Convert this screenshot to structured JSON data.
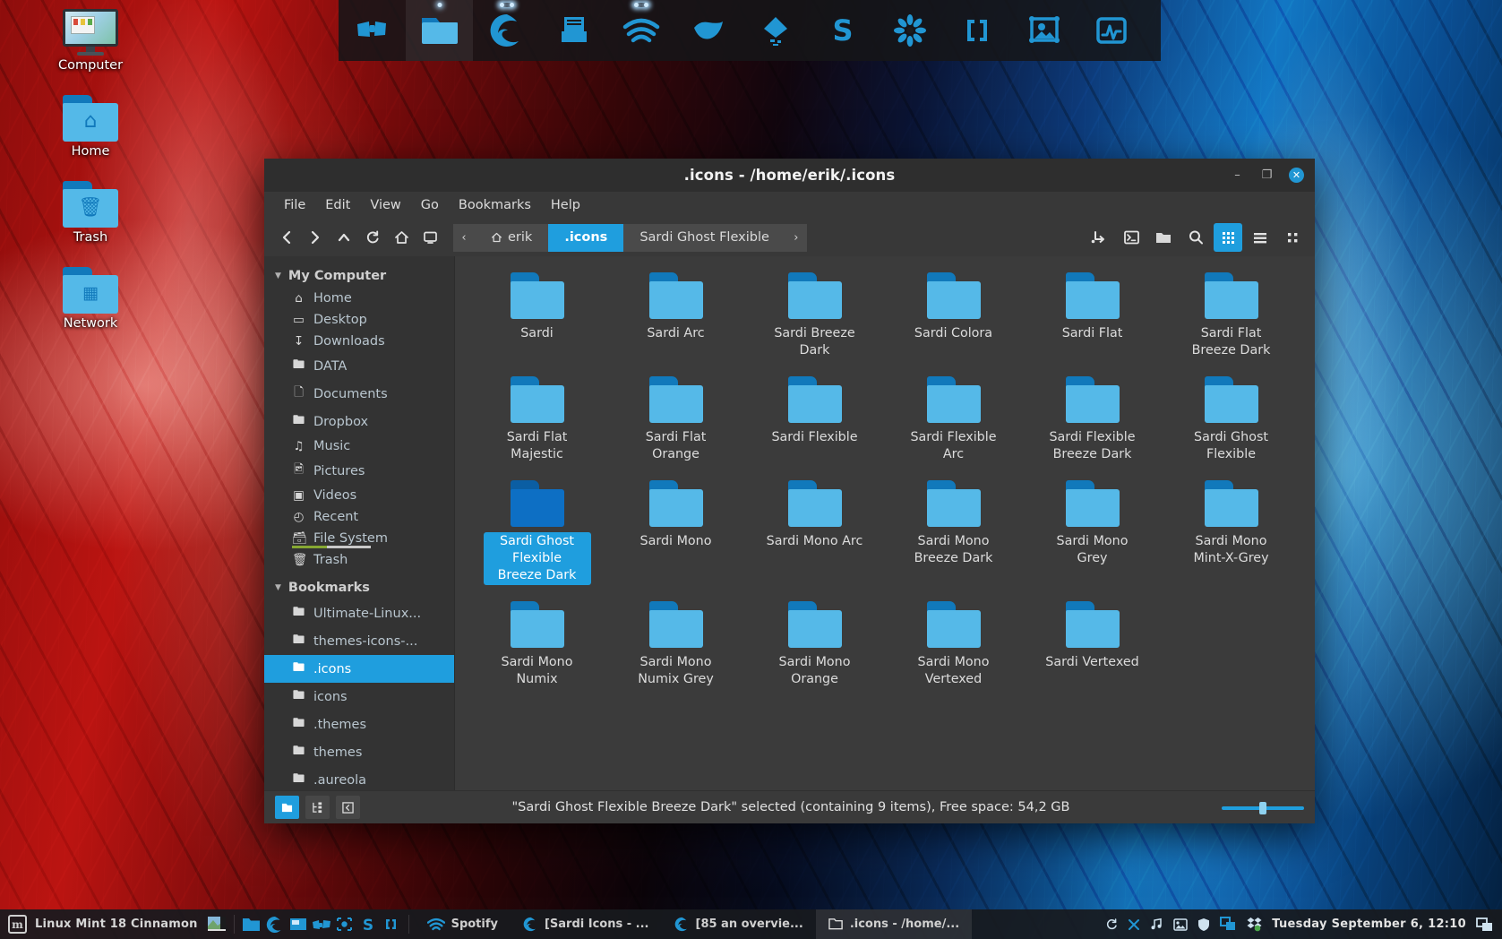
{
  "desktop": {
    "icons": [
      {
        "label": "Computer",
        "icon": "computer-icon"
      },
      {
        "label": "Home",
        "icon": "home-folder-icon"
      },
      {
        "label": "Trash",
        "icon": "trash-folder-icon"
      },
      {
        "label": "Network",
        "icon": "network-folder-icon"
      }
    ]
  },
  "dock": {
    "items": [
      {
        "name": "bowtie-icon",
        "active": false,
        "running": false
      },
      {
        "name": "file-manager-icon",
        "active": true,
        "running": true
      },
      {
        "name": "firefox-icon",
        "active": false,
        "running": true
      },
      {
        "name": "text-editor-icon",
        "active": false,
        "running": false
      },
      {
        "name": "spotify-icon",
        "active": false,
        "running": true
      },
      {
        "name": "gimp-icon",
        "active": false,
        "running": false
      },
      {
        "name": "inkscape-icon",
        "active": false,
        "running": false
      },
      {
        "name": "sublime-icon",
        "active": false,
        "running": false
      },
      {
        "name": "pinwheel-icon",
        "active": false,
        "running": false
      },
      {
        "name": "brackets-icon",
        "active": false,
        "running": false
      },
      {
        "name": "image-viewer-icon",
        "active": false,
        "running": false
      },
      {
        "name": "system-monitor-icon",
        "active": false,
        "running": false
      }
    ]
  },
  "window": {
    "title": ".icons - /home/erik/.icons",
    "controls": {
      "minimize": "–",
      "maximize": "❐",
      "close": "✕"
    },
    "menus": [
      "File",
      "Edit",
      "View",
      "Go",
      "Bookmarks",
      "Help"
    ],
    "toolbar": {
      "nav": [
        {
          "name": "back-button",
          "glyph": "‹"
        },
        {
          "name": "forward-button",
          "glyph": "›"
        },
        {
          "name": "up-button",
          "glyph": "⌃"
        },
        {
          "name": "reload-button",
          "glyph": "↻"
        },
        {
          "name": "home-button",
          "glyph": "⌂"
        },
        {
          "name": "toggle-location-button",
          "glyph": "□"
        }
      ],
      "path_prev_glyph": "‹",
      "path_next_glyph": "›",
      "breadcrumbs": [
        {
          "label": "erik",
          "icon": "home-icon",
          "active": false
        },
        {
          "label": ".icons",
          "icon": "",
          "active": true
        },
        {
          "label": "Sardi Ghost Flexible",
          "icon": "",
          "active": false
        }
      ],
      "actions": [
        {
          "name": "split-pane-button"
        },
        {
          "name": "open-terminal-button"
        },
        {
          "name": "new-folder-button"
        },
        {
          "name": "search-button"
        }
      ],
      "views": [
        {
          "name": "icon-view-button",
          "active": true
        },
        {
          "name": "list-view-button",
          "active": false
        },
        {
          "name": "compact-view-button",
          "active": false
        }
      ]
    },
    "sidebar": {
      "sections": [
        {
          "title": "My Computer",
          "caret": "▼",
          "items": [
            {
              "label": "Home",
              "icon": "home-icon",
              "glyph": "⌂",
              "selected": false
            },
            {
              "label": "Desktop",
              "icon": "desktop-icon",
              "glyph": "▭",
              "selected": false
            },
            {
              "label": "Downloads",
              "icon": "downloads-icon",
              "glyph": "⤓",
              "selected": false
            },
            {
              "label": "DATA",
              "icon": "folder-icon",
              "glyph": "὜0",
              "selected": false
            },
            {
              "label": "Documents",
              "icon": "document-icon",
              "glyph": "὜b",
              "selected": false
            },
            {
              "label": "Dropbox",
              "icon": "dropbox-folder-icon",
              "glyph": "὜0",
              "selected": false
            },
            {
              "label": "Music",
              "icon": "music-icon",
              "glyph": "♫",
              "selected": false
            },
            {
              "label": "Pictures",
              "icon": "pictures-icon",
              "glyph": "Ὓb",
              "selected": false
            },
            {
              "label": "Videos",
              "icon": "videos-icon",
              "glyph": "Ἱe",
              "selected": false
            },
            {
              "label": "Recent",
              "icon": "recent-icon",
              "glyph": "◴",
              "selected": false
            },
            {
              "label": "File System",
              "icon": "filesystem-icon",
              "glyph": "Ὓ3",
              "selected": false,
              "usage": true
            },
            {
              "label": "Trash",
              "icon": "trash-icon",
              "glyph": "Ὕ1",
              "selected": false
            }
          ]
        },
        {
          "title": "Bookmarks",
          "caret": "▼",
          "items": [
            {
              "label": "Ultimate-Linux...",
              "icon": "folder-icon",
              "glyph": "὜0",
              "selected": false
            },
            {
              "label": "themes-icons-...",
              "icon": "folder-icon",
              "glyph": "὜0",
              "selected": false
            },
            {
              "label": ".icons",
              "icon": "folder-icon",
              "glyph": "὜0",
              "selected": true
            },
            {
              "label": "icons",
              "icon": "folder-icon",
              "glyph": "὜0",
              "selected": false
            },
            {
              "label": ".themes",
              "icon": "folder-icon",
              "glyph": "὜0",
              "selected": false
            },
            {
              "label": "themes",
              "icon": "folder-icon",
              "glyph": "὜0",
              "selected": false
            },
            {
              "label": ".aureola",
              "icon": "folder-icon",
              "glyph": "὜0",
              "selected": false
            }
          ]
        }
      ]
    },
    "files": [
      {
        "name": "Sardi",
        "selected": false
      },
      {
        "name": "Sardi Arc",
        "selected": false
      },
      {
        "name": "Sardi Breeze Dark",
        "selected": false
      },
      {
        "name": "Sardi Colora",
        "selected": false
      },
      {
        "name": "Sardi Flat",
        "selected": false
      },
      {
        "name": "Sardi Flat Breeze Dark",
        "selected": false
      },
      {
        "name": "Sardi Flat Majestic",
        "selected": false
      },
      {
        "name": "Sardi Flat Orange",
        "selected": false
      },
      {
        "name": "Sardi Flexible",
        "selected": false
      },
      {
        "name": "Sardi Flexible Arc",
        "selected": false
      },
      {
        "name": "Sardi Flexible Breeze Dark",
        "selected": false
      },
      {
        "name": "Sardi Ghost Flexible",
        "selected": false
      },
      {
        "name": "Sardi Ghost Flexible Breeze Dark",
        "selected": true
      },
      {
        "name": "Sardi Mono",
        "selected": false
      },
      {
        "name": "Sardi Mono Arc",
        "selected": false
      },
      {
        "name": "Sardi Mono Breeze Dark",
        "selected": false
      },
      {
        "name": "Sardi Mono Grey",
        "selected": false
      },
      {
        "name": "Sardi Mono Mint-X-Grey",
        "selected": false
      },
      {
        "name": "Sardi Mono Numix",
        "selected": false
      },
      {
        "name": "Sardi Mono Numix Grey",
        "selected": false
      },
      {
        "name": "Sardi Mono Orange",
        "selected": false
      },
      {
        "name": "Sardi Mono Vertexed",
        "selected": false
      },
      {
        "name": "Sardi Vertexed",
        "selected": false
      }
    ],
    "statusbar": {
      "text": "\"Sardi Ghost Flexible Breeze Dark\" selected (containing 9 items), Free space: 54,2 GB",
      "buttons": [
        {
          "name": "places-pane-button",
          "active": true
        },
        {
          "name": "tree-pane-button",
          "active": false
        },
        {
          "name": "hide-sidebar-button",
          "active": false
        }
      ],
      "zoom_percent": 46
    }
  },
  "taskbar": {
    "menu_label": "Linux Mint 18 Cinnamon",
    "menu_logo": "m",
    "launchers": [
      {
        "name": "show-desktop-icon"
      },
      {
        "name": "file-manager-launcher"
      },
      {
        "name": "firefox-launcher"
      },
      {
        "name": "screenshot-launcher"
      },
      {
        "name": "bowtie-launcher"
      },
      {
        "name": "camera-launcher"
      },
      {
        "name": "sublime-launcher"
      },
      {
        "name": "brackets-launcher"
      }
    ],
    "tasks": [
      {
        "label": "Spotify",
        "icon": "spotify-icon",
        "active": false
      },
      {
        "label": "[Sardi Icons - ...",
        "icon": "firefox-icon",
        "active": false
      },
      {
        "label": "[85 an overvie...",
        "icon": "firefox-icon",
        "active": false
      },
      {
        "label": ".icons - /home/...",
        "icon": "folder-icon",
        "active": true
      }
    ],
    "tray": [
      {
        "name": "refresh-icon"
      },
      {
        "name": "close-icon"
      },
      {
        "name": "music-note-icon"
      },
      {
        "name": "image-icon"
      },
      {
        "name": "shield-icon"
      },
      {
        "name": "workspace-switcher-icon"
      },
      {
        "name": "dropbox-icon"
      }
    ],
    "clock": "Tuesday September  6, 12:10",
    "show_desktop": "show-desktop-button"
  },
  "colors": {
    "accent": "#1f9ede",
    "folder_body": "#55b9e8",
    "folder_tab": "#1179bb",
    "window_bg": "#383838",
    "sidebar_bg": "#333333",
    "content_bg": "#3b3b3b"
  }
}
